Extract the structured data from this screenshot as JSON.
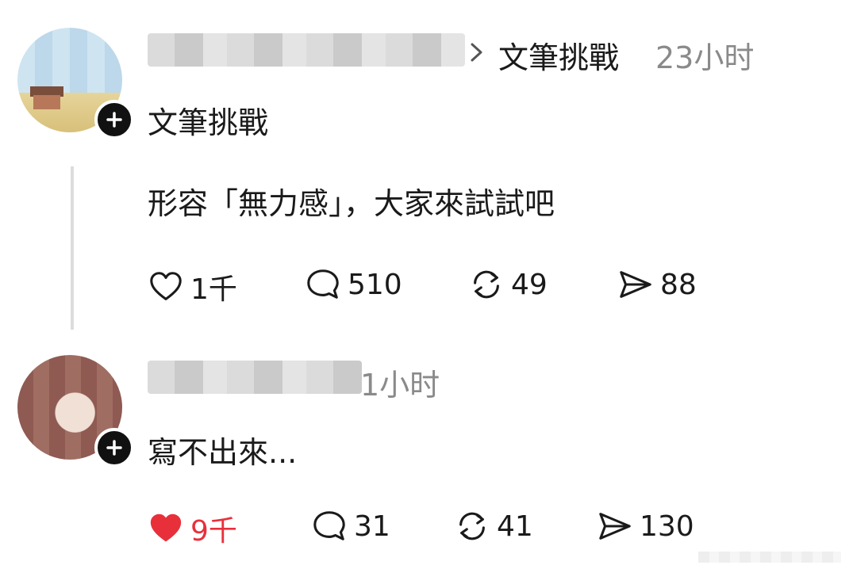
{
  "post": {
    "channel": "文筆挑戰",
    "time": "23小时",
    "title": "文筆挑戰",
    "body": "形容「無力感」，大家來試試吧",
    "actions": {
      "likes": "1千",
      "comments": "510",
      "reposts": "49",
      "shares": "88"
    }
  },
  "reply": {
    "time_partial": "1小时",
    "body": "寫不出來...",
    "actions": {
      "likes": "9千",
      "comments": "31",
      "reposts": "41",
      "shares": "130"
    }
  },
  "colors": {
    "like_active": "#e8303b",
    "text": "#1a1a1a",
    "muted": "#8a8a8a"
  }
}
